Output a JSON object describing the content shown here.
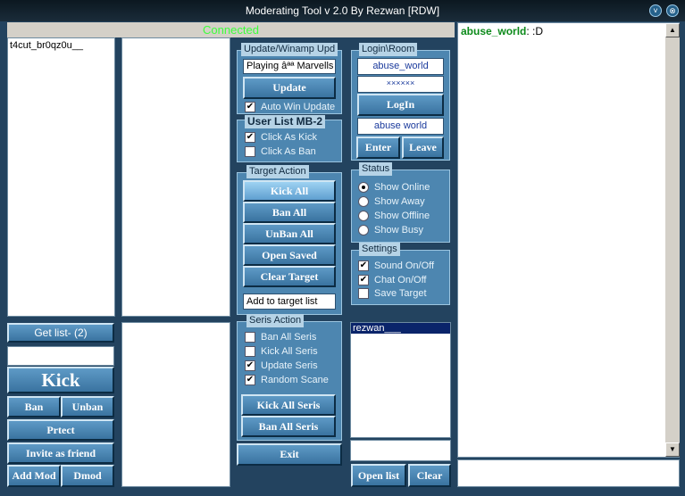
{
  "window": {
    "title": "Moderating Tool v 2.0 By Rezwan  [RDW]",
    "status": "Connected"
  },
  "users_list": [
    "t4cut_br0qz0u__"
  ],
  "left_controls": {
    "get_list": "Get list- (2)",
    "kick": "Kick",
    "ban": "Ban",
    "unban": "Unban",
    "protect": "Prtect",
    "invite": "Invite as friend",
    "add_mod": "Add Mod",
    "dmod": "Dmod"
  },
  "update_panel": {
    "title": "Update/Winamp Upd",
    "now_playing": "Playing âªª Marvells  I",
    "update_button": "Update",
    "auto_update": "Auto Win Update"
  },
  "userlist_panel": {
    "title": "User List MB-2",
    "click_kick": "Click As Kick",
    "click_ban": "Click As Ban"
  },
  "target_panel": {
    "title": "Target Action",
    "kick_all": "Kick All",
    "ban_all": "Ban All",
    "unban_all": "UnBan All",
    "open_saved": "Open Saved",
    "clear_target": "Clear Target",
    "add_target": "Add to target list"
  },
  "seris_panel": {
    "title": "Seris Action",
    "ban_all_seris": "Ban All Seris",
    "kick_all_seris": "Kick All Seris",
    "update_seris": "Update Seris",
    "random_scane": "Random Scane",
    "kick_all_btn": "Kick All Seris",
    "ban_all_btn": "Ban All Seris"
  },
  "exit": "Exit",
  "login_panel": {
    "title": "Login\\Room",
    "username": "abuse_world",
    "password": "××××××",
    "login": "LogIn",
    "room": "abuse world",
    "enter": "Enter",
    "leave": "Leave"
  },
  "status_panel": {
    "title": "Status",
    "online": "Show Online",
    "away": "Show Away",
    "offline": "Show Offline",
    "busy": "Show Busy"
  },
  "settings_panel": {
    "title": "Settings",
    "sound": "Sound On/Off",
    "chat": "Chat On/Off",
    "save_target": "Save Target"
  },
  "room_list": [
    "rezwan___"
  ],
  "room_buttons": {
    "open_list": "Open list",
    "clear": "Clear"
  },
  "chat": {
    "user": "abuse_world",
    "message": ": :D"
  },
  "checked": "✔",
  "icons": {
    "minimize": "˅",
    "close": "⊗"
  }
}
